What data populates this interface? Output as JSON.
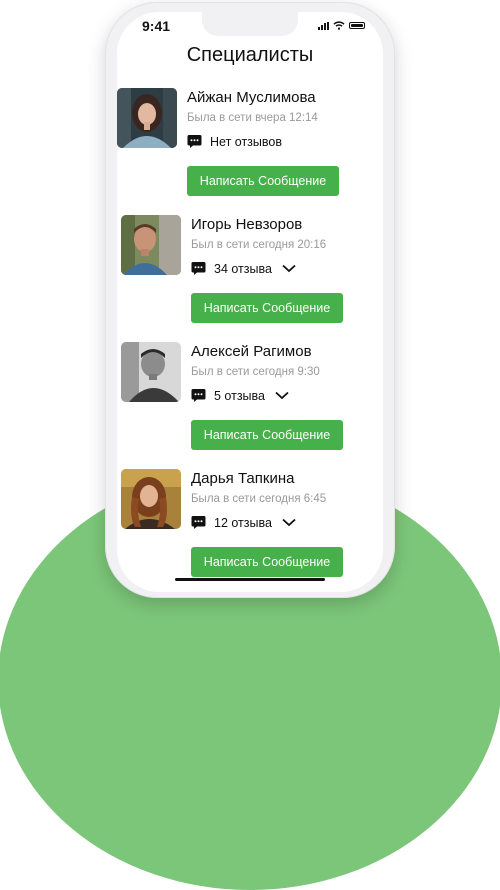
{
  "status_bar": {
    "time": "9:41"
  },
  "page": {
    "title": "Специалисты"
  },
  "colors": {
    "accent": "#46b04a",
    "background_blob": "#7cc679"
  },
  "specialists": [
    {
      "name": "Айжан Муслимова",
      "last_seen": "Была в сети вчера 12:14",
      "reviews": "Нет отзывов",
      "has_dropdown": false,
      "button_label": "Написать Сообщение"
    },
    {
      "name": "Игорь Невзоров",
      "last_seen": "Был в сети сегодня 20:16",
      "reviews": "34 отзыва",
      "has_dropdown": true,
      "button_label": "Написать Сообщение"
    },
    {
      "name": "Алексей Рагимов",
      "last_seen": "Был в сети сегодня 9:30",
      "reviews": "5 отзыва",
      "has_dropdown": true,
      "button_label": "Написать Сообщение"
    },
    {
      "name": "Дарья Тапкина",
      "last_seen": "Была в сети сегодня 6:45",
      "reviews": "12 отзыва",
      "has_dropdown": true,
      "button_label": "Написать Сообщение"
    }
  ]
}
